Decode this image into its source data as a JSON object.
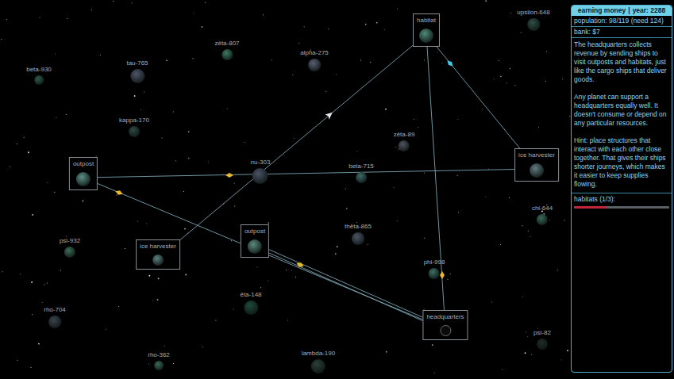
{
  "hud": {
    "title": "earning money",
    "separator": "|",
    "year": "year: 2288",
    "population": "population: 98/119 (need 124)",
    "bank": "bank: $7",
    "description": [
      "The headquarters collects revenue by sending ships to visit outposts and habitats, just like the cargo ships that deliver goods.",
      "Any planet can support a headquarters equally well. It doesn't consume or depend on any particular resources.",
      "Hint: place structures that interact with each other close together. That gives their ships shorter journeys, which makes it easier to keep supplies flowing."
    ],
    "goal": {
      "label": "habitats (1/3):",
      "level": 0.33
    }
  },
  "planets": [
    {
      "name": "upsilon-648",
      "kind": "planet",
      "color": "#2f4f46"
    },
    {
      "name": "habitat",
      "kind": "structure",
      "color": "#4e8a78"
    },
    {
      "name": "zêta-807",
      "kind": "planet",
      "color": "#3e7a62"
    },
    {
      "name": "alpha-275",
      "kind": "planet",
      "color": "#5a5f72"
    },
    {
      "name": "beta-930",
      "kind": "planet",
      "color": "#2f5a4c"
    },
    {
      "name": "tau-765",
      "kind": "planet",
      "color": "#50556a"
    },
    {
      "name": "kappa-170",
      "kind": "planet",
      "color": "#2e4a42"
    },
    {
      "name": "zêta-89",
      "kind": "planet",
      "color": "#4e5560"
    },
    {
      "name": "outpost",
      "kind": "structure",
      "color": "#5b8f85"
    },
    {
      "name": "nu-303",
      "kind": "planet",
      "color": "#4a5266"
    },
    {
      "name": "beta-715",
      "kind": "planet",
      "color": "#3e6a6a"
    },
    {
      "name": "ice harvester",
      "kind": "structure",
      "color": "#607a80"
    },
    {
      "name": "chi-644",
      "kind": "planet",
      "color": "#3a6a5a"
    },
    {
      "name": "psi-932",
      "kind": "planet",
      "color": "#3b6e58"
    },
    {
      "name": "ice harvester",
      "kind": "structure",
      "color": "#5e8080"
    },
    {
      "name": "outpost",
      "kind": "structure",
      "color": "#5d8a7e"
    },
    {
      "name": "thêta-865",
      "kind": "planet",
      "color": "#4b5566"
    },
    {
      "name": "phi-998",
      "kind": "planet",
      "color": "#3d6f60"
    },
    {
      "name": "headquarters",
      "kind": "structure",
      "color": "#0a0a0a"
    },
    {
      "name": "êta-148",
      "kind": "planet",
      "color": "#1f4a3a"
    },
    {
      "name": "rho-704",
      "kind": "planet",
      "color": "#3c4450"
    },
    {
      "name": "psi-82",
      "kind": "planet",
      "color": "#1f2a2a"
    },
    {
      "name": "rho-362",
      "kind": "planet",
      "color": "#3a6a55"
    },
    {
      "name": "lambda-190",
      "kind": "planet",
      "color": "#2a3f38"
    }
  ],
  "routes": [
    {
      "from": 18,
      "to": 1,
      "lanes": 1
    },
    {
      "from": 18,
      "to": 8,
      "lanes": 1
    },
    {
      "from": 18,
      "to": 15,
      "lanes": 2
    },
    {
      "from": 1,
      "to": 11,
      "lanes": 1
    },
    {
      "from": 1,
      "to": 14,
      "lanes": 1
    },
    {
      "from": 8,
      "to": 11,
      "lanes": 1
    }
  ],
  "ships": [
    {
      "kind": "diamond",
      "color": "#e8b830"
    },
    {
      "kind": "diamond",
      "color": "#e8b830"
    },
    {
      "kind": "diamond",
      "color": "#e8b830"
    },
    {
      "kind": "diamond",
      "color": "#e8b830"
    },
    {
      "kind": "diamond",
      "color": "#3fc8e8"
    },
    {
      "kind": "arrow",
      "color": "#e8e8e8"
    }
  ]
}
